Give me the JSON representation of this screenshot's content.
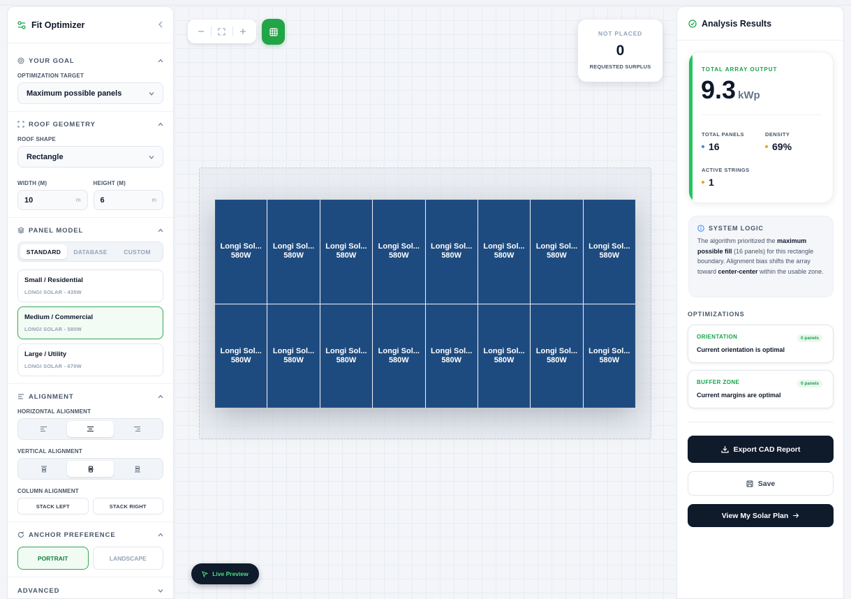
{
  "sidebar": {
    "title": "Fit Optimizer",
    "goal": {
      "section_title": "YOUR GOAL",
      "target_label": "OPTIMIZATION TARGET",
      "target_value": "Maximum possible panels"
    },
    "roof": {
      "section_title": "ROOF GEOMETRY",
      "shape_label": "ROOF SHAPE",
      "shape_value": "Rectangle",
      "width_label": "WIDTH (M)",
      "width_value": "10",
      "width_unit": "m",
      "height_label": "HEIGHT (M)",
      "height_value": "6",
      "height_unit": "m"
    },
    "panel_model": {
      "section_title": "PANEL MODEL",
      "tabs": [
        "STANDARD",
        "DATABASE",
        "CUSTOM"
      ],
      "options": [
        {
          "title": "Small / Residential",
          "subtitle": "LONGI SOLAR - 435W"
        },
        {
          "title": "Medium / Commercial",
          "subtitle": "LONGI SOLAR - 580W"
        },
        {
          "title": "Large / Utility",
          "subtitle": "LONGI SOLAR - 670W"
        }
      ]
    },
    "alignment": {
      "section_title": "ALIGNMENT",
      "horizontal_label": "HORIZONTAL ALIGNMENT",
      "vertical_label": "VERTICAL ALIGNMENT",
      "column_label": "COLUMN ALIGNMENT",
      "stack_left": "STACK LEFT",
      "stack_right": "STACK RIGHT"
    },
    "anchor": {
      "section_title": "ANCHOR PREFERENCE",
      "portrait": "PORTRAIT",
      "landscape": "LANDSCAPE"
    },
    "advanced": "ADVANCED"
  },
  "canvas": {
    "not_placed_label": "NOT PLACED",
    "not_placed_value": "0",
    "not_placed_sub": "REQUESTED SURPLUS",
    "panel_name": "Longi Sol...",
    "panel_watt": "580W",
    "panel_count": 16,
    "live_preview": "Live Preview"
  },
  "results": {
    "title": "Analysis Results",
    "output_label": "TOTAL ARRAY OUTPUT",
    "output_value": "9.3",
    "output_unit": "kWp",
    "total_panels_label": "TOTAL PANELS",
    "total_panels_value": "16",
    "density_label": "DENSITY",
    "density_value": "69%",
    "strings_label": "ACTIVE STRINGS",
    "strings_value": "1",
    "logic_title": "SYSTEM LOGIC",
    "logic_text_1": "The algorithm prioritized the ",
    "logic_bold_1": "maximum possible fill",
    "logic_text_2": " (16 panels) for this rectangle boundary. Alignment bias shifts the array toward ",
    "logic_bold_2": "center-center",
    "logic_text_3": " within the usable zone.",
    "optimizations_title": "OPTIMIZATIONS",
    "orientation_title": "ORIENTATION",
    "orientation_badge": "0 panels",
    "orientation_desc": "Current orientation is optimal",
    "buffer_title": "BUFFER ZONE",
    "buffer_badge": "0 panels",
    "buffer_desc": "Current margins are optimal",
    "export_label": "Export CAD Report",
    "save_label": "Save",
    "view_label": "View My Solar Plan"
  },
  "colors": {
    "accent_green": "#22a447",
    "panel_blue": "#1e4b7f",
    "dark_button": "#0f1a2b"
  }
}
